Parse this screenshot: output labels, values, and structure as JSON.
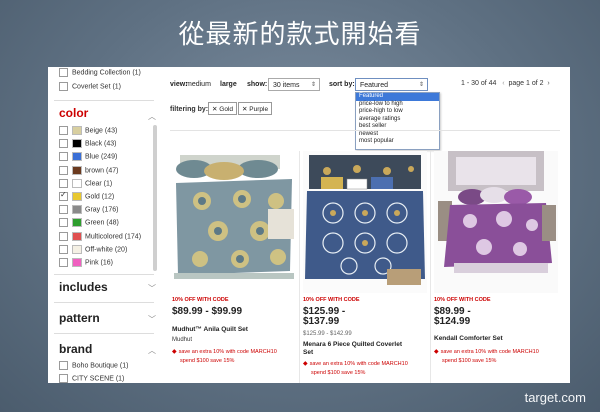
{
  "slide": {
    "title": "從最新的款式開始看",
    "footer": "target.com"
  },
  "sidebar": {
    "top_items": [
      {
        "label": "Bedding Collection (1)"
      },
      {
        "label": "Coverlet Set (1)"
      }
    ],
    "color_section": {
      "title": "color",
      "items": [
        {
          "label": "Beige (43)",
          "color": "#d8cfa0",
          "checked": false
        },
        {
          "label": "Black (43)",
          "color": "#000000",
          "checked": false
        },
        {
          "label": "Blue (249)",
          "color": "#3a6fd6",
          "checked": false
        },
        {
          "label": "brown (47)",
          "color": "#6b3a1f",
          "checked": false
        },
        {
          "label": "Clear (1)",
          "color": "#ffffff",
          "checked": false
        },
        {
          "label": "Gold (12)",
          "color": "#e8c830",
          "checked": true
        },
        {
          "label": "Gray (176)",
          "color": "#8a8a8a",
          "checked": false
        },
        {
          "label": "Green (48)",
          "color": "#2e9e2e",
          "checked": false
        },
        {
          "label": "Multicolored (174)",
          "color": "#e05050",
          "checked": false
        },
        {
          "label": "Off-white (20)",
          "color": "#f4f0e4",
          "checked": false
        },
        {
          "label": "Pink (16)",
          "color": "#f060c0",
          "checked": false
        }
      ]
    },
    "sections": [
      {
        "title": "includes"
      },
      {
        "title": "pattern"
      },
      {
        "title": "brand"
      }
    ],
    "brand_items": [
      {
        "label": "Boho Boutique (1)"
      },
      {
        "label": "CITY SCENE (1)"
      }
    ]
  },
  "toolbar": {
    "view_label": "view:",
    "view_medium": "medium",
    "view_large": "large",
    "show_label": "show:",
    "show_value": "30 items",
    "sort_label": "sort by:",
    "sort_value": "Featured",
    "pager_range": "1 - 30 of 44",
    "pager_page": "page 1 of 2",
    "sort_options": [
      "Featured",
      "price-low to high",
      "price-high to low",
      "average ratings",
      "best seller",
      "newest",
      "most popular"
    ]
  },
  "filters": {
    "label": "filtering by:",
    "chips": [
      "Gold",
      "Purple"
    ]
  },
  "products": [
    {
      "promo": "10% OFF WITH CODE",
      "price": "$89.99 - $99.99",
      "name": "Mudhut™ Anila Quilt Set",
      "brand": "Mudhut",
      "offer1": "save an extra 10% with code MARCH10",
      "offer2": "spend $100 save 15%"
    },
    {
      "promo": "10% OFF WITH CODE",
      "price_line1": "$125.99 -",
      "price_line2": "$137.99",
      "sub_price": "$125.99 - $142.99",
      "name_line1": "Menara 6 Piece Quilted Coverlet",
      "name_line2": "Set",
      "offer1": "save an extra 10% with code MARCH10",
      "offer2": "spend $100 save 15%"
    },
    {
      "promo": "10% OFF WITH CODE",
      "price_line1": "$89.99 -",
      "price_line2": "$124.99",
      "name": "Kendall Comforter Set",
      "offer1": "save an extra 10% with code MARCH10",
      "offer2": "spend $100 save 15%"
    }
  ],
  "colors": {
    "accent_red": "#cc0000",
    "dropdown_highlight": "#3d79d9"
  }
}
